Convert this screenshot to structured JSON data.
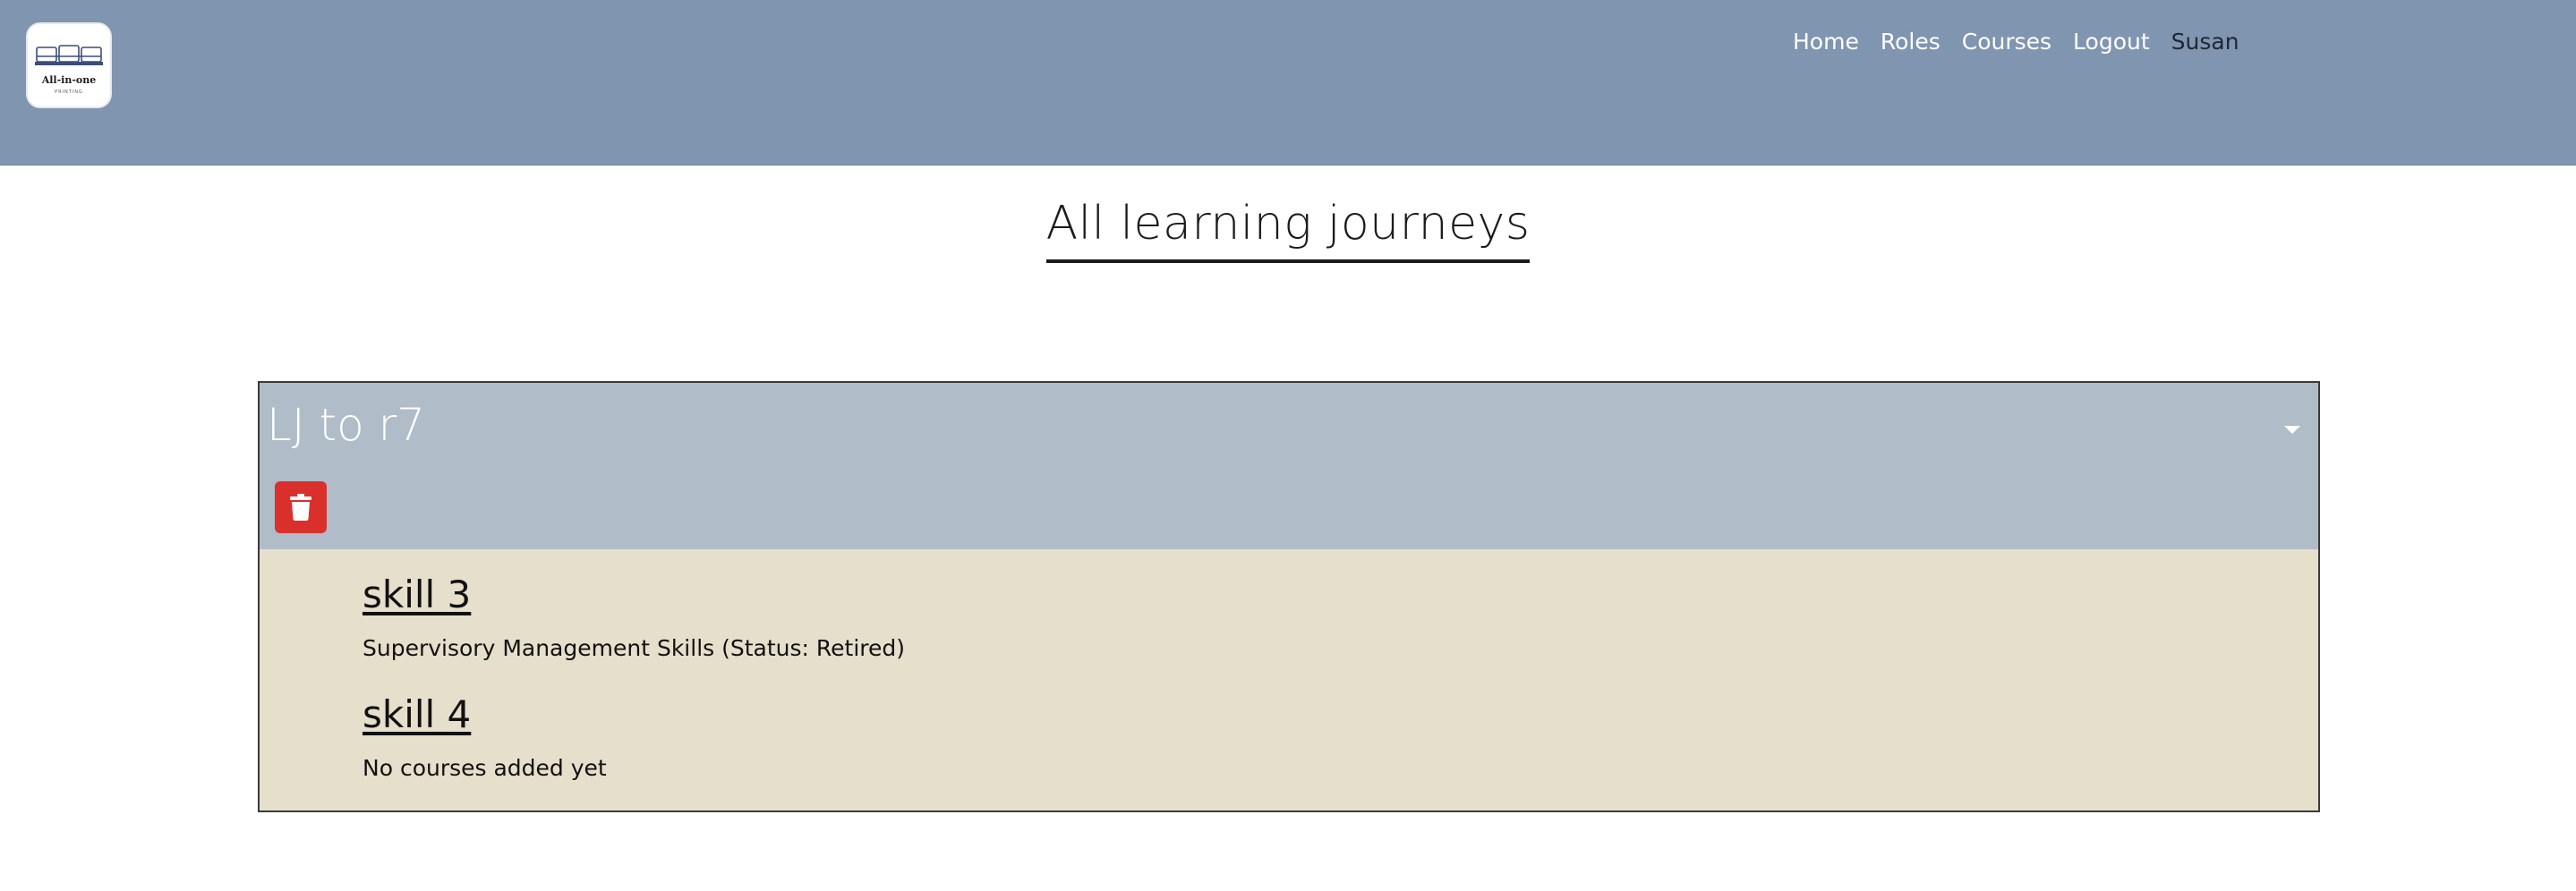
{
  "navbar": {
    "logo": {
      "text": "All-in-one",
      "subtext": "PRINTING",
      "icon": "printer-logo-icon"
    },
    "links": [
      {
        "label": "Home"
      },
      {
        "label": "Roles"
      },
      {
        "label": "Courses"
      },
      {
        "label": "Logout"
      }
    ],
    "user": "Susan",
    "background_color": "#8095b0"
  },
  "page": {
    "title": "All learning journeys"
  },
  "journeys": [
    {
      "title": "LJ to r7",
      "toggle_icon": "caret-down-icon",
      "delete_icon": "trash-icon",
      "skills": [
        {
          "title": "skill 3",
          "description": "Supervisory Management Skills (Status: Retired)"
        },
        {
          "title": "skill 4",
          "description": "No courses added yet"
        }
      ]
    }
  ],
  "colors": {
    "header_bg": "#8095b0",
    "card_header_bg": "#b0bcc8",
    "card_body_bg": "#e6dfcb",
    "delete_button": "#d9302c"
  }
}
